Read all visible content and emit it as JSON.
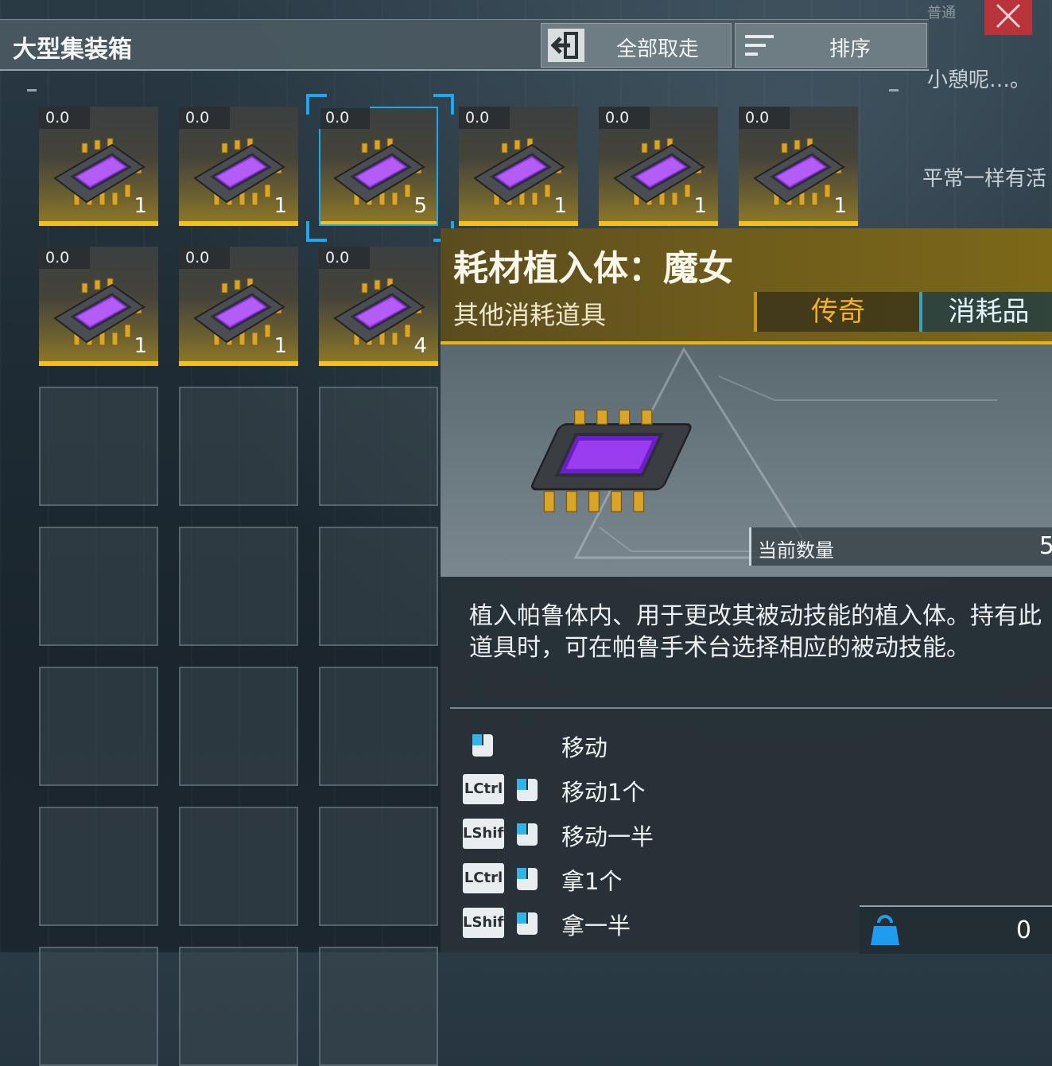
{
  "container": {
    "title": "大型集装箱",
    "take_all_label": "全部取走",
    "sort_label": "排序"
  },
  "background_text": {
    "line1": "小憩呢…。",
    "line2": "平常一样有活",
    "top": "普通"
  },
  "slots": [
    {
      "weight": "0.0",
      "count": "1"
    },
    {
      "weight": "0.0",
      "count": "1"
    },
    {
      "weight": "0.0",
      "count": "5",
      "selected": true
    },
    {
      "weight": "0.0",
      "count": "1"
    },
    {
      "weight": "0.0",
      "count": "1"
    },
    {
      "weight": "0.0",
      "count": "1"
    },
    {
      "weight": "0.0",
      "count": "1"
    },
    {
      "weight": "0.0",
      "count": "1"
    },
    {
      "weight": "0.0",
      "count": "4"
    }
  ],
  "detail": {
    "name": "耗材植入体：魔女",
    "category": "其他消耗道具",
    "rarity": "传奇",
    "type": "消耗品",
    "quantity_label": "当前数量",
    "quantity_value": "5",
    "description": "植入帕鲁体内、用于更改其被动技能的植入体。持有此道具时，可在帕鲁手术台选择相应的被动技能。"
  },
  "controls": [
    {
      "key": "",
      "label": "移动"
    },
    {
      "key": "LCtrl",
      "label": "移动1个"
    },
    {
      "key": "LShift",
      "label": "移动一半"
    },
    {
      "key": "LCtrl",
      "label": "拿1个"
    },
    {
      "key": "LShift",
      "label": "拿一半"
    }
  ],
  "wallet": {
    "amount": "0"
  },
  "colors": {
    "legendary": "#f6b32a",
    "selection": "#1aa8f0",
    "slot_underline": "#f0c020",
    "close": "#b8333a"
  }
}
